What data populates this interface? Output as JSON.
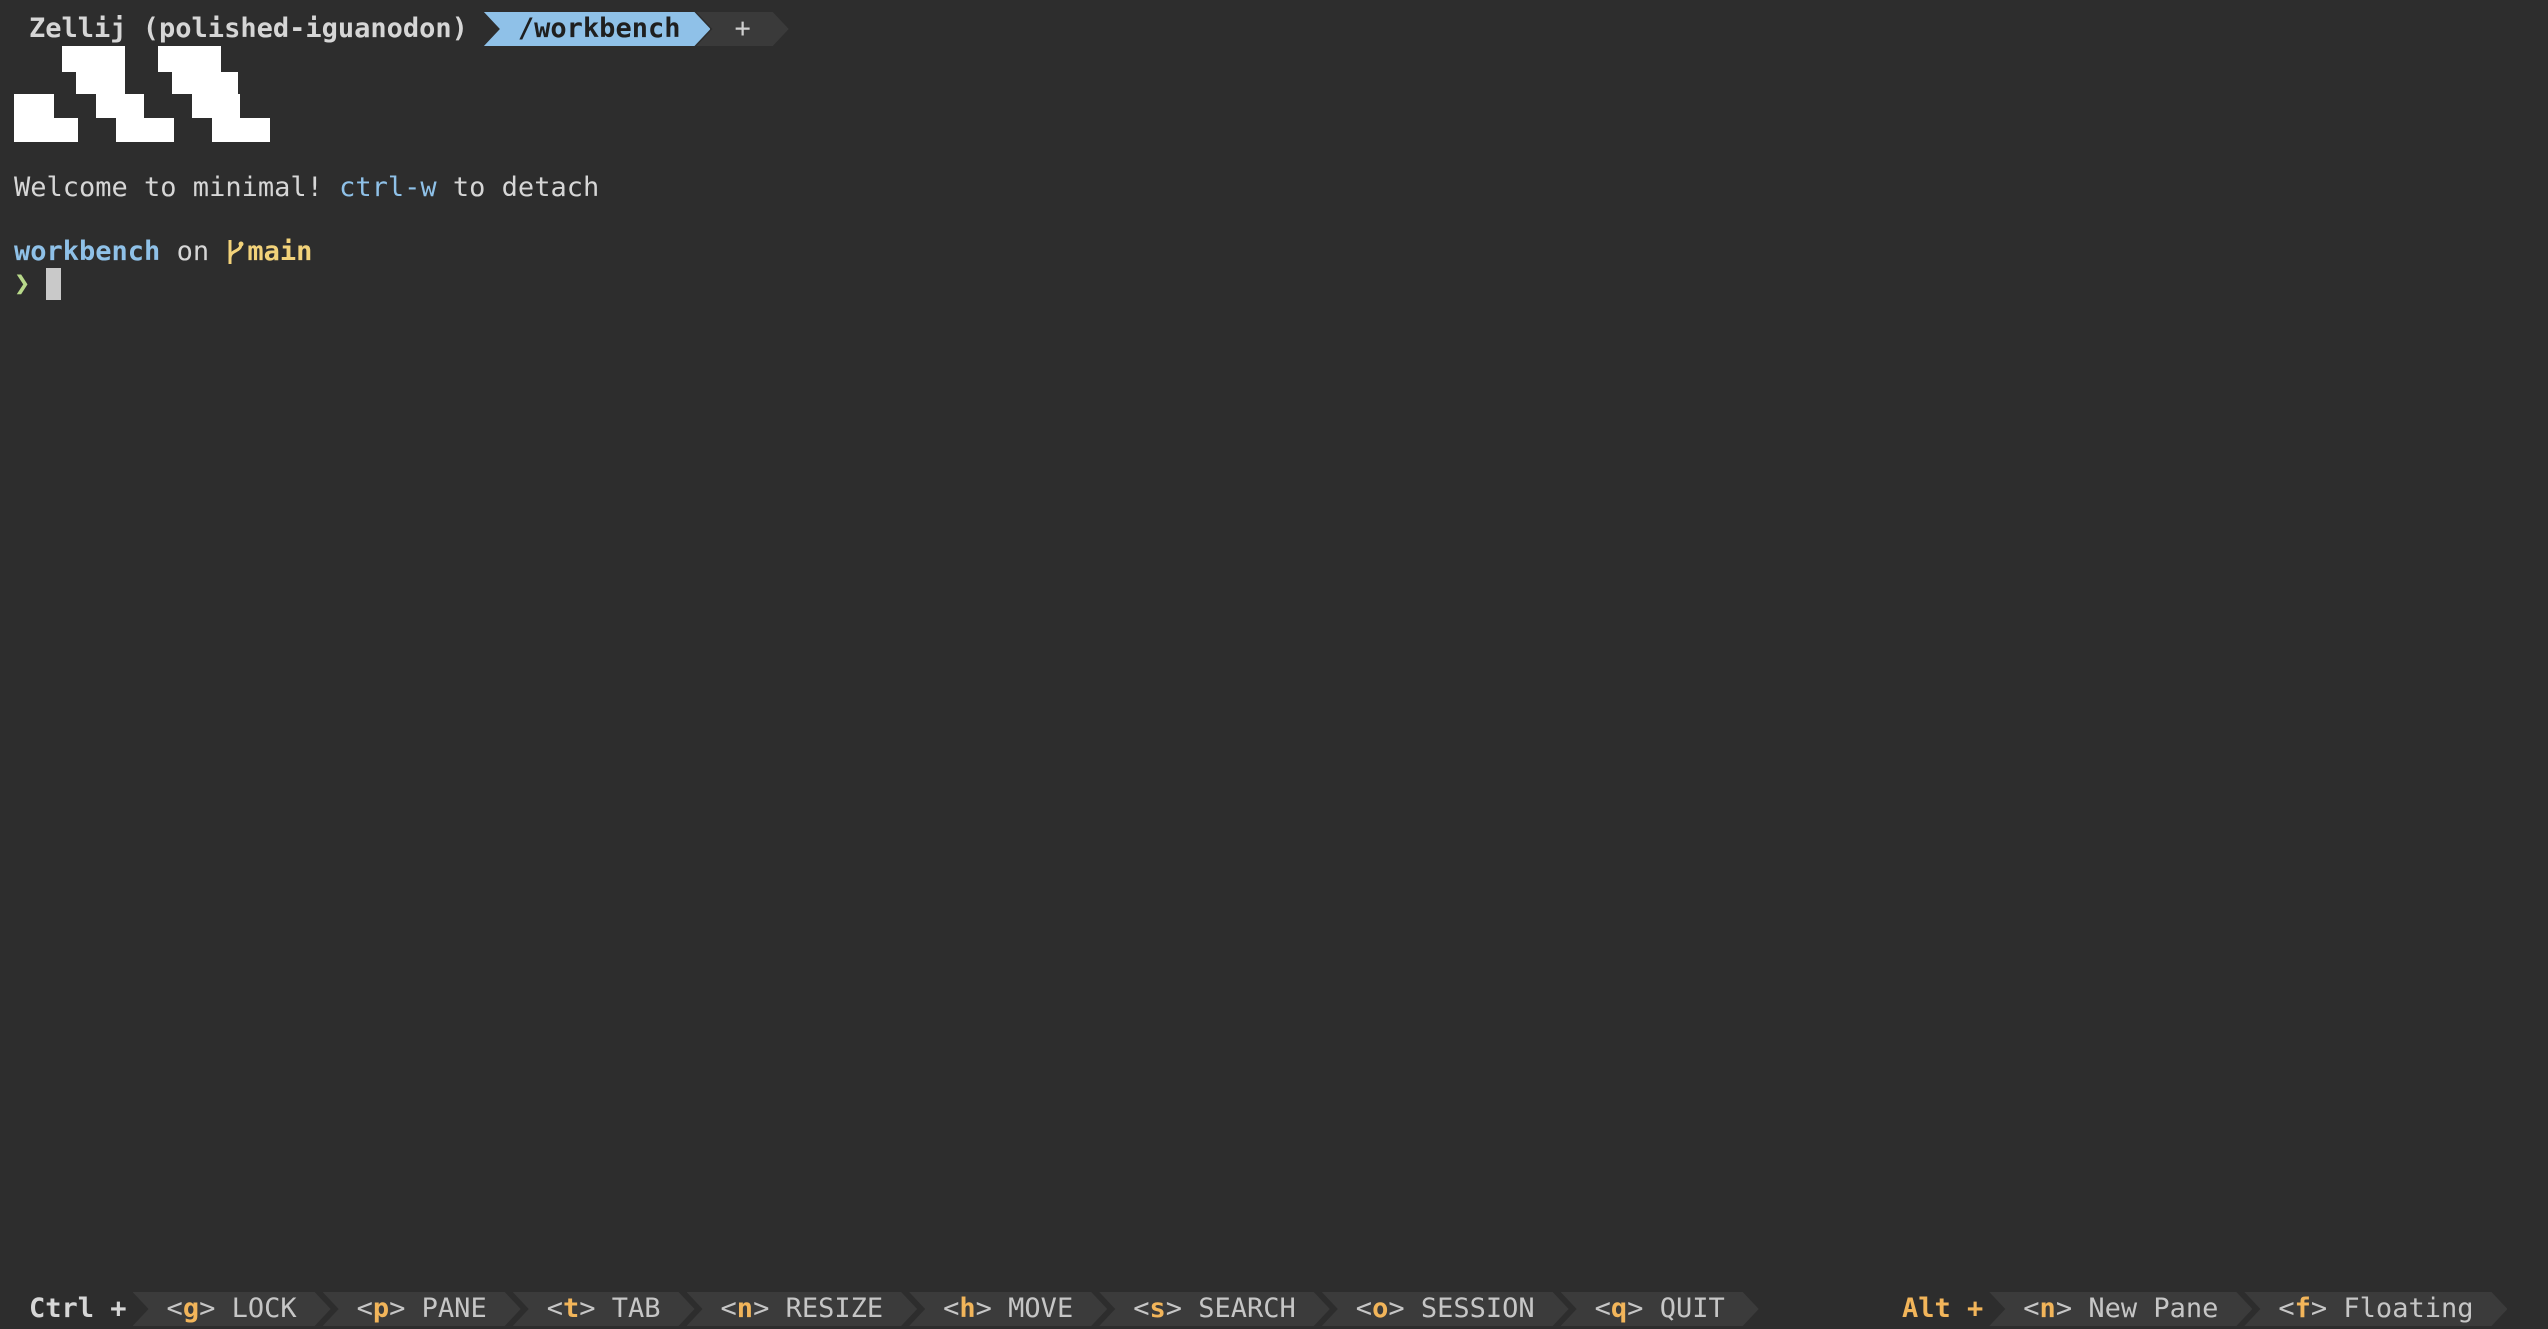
{
  "tabbar": {
    "session": "Zellij (polished-iguanodon)",
    "active_tab": "/workbench",
    "new_tab": "+"
  },
  "terminal": {
    "welcome_prefix": "Welcome to minimal! ",
    "welcome_key": "ctrl-w",
    "welcome_suffix": " to detach",
    "dir": "workbench",
    "on": " on ",
    "branch": "main",
    "prompt_char": "❯"
  },
  "statusbar": {
    "ctrl_prefix": "Ctrl +",
    "ctrl_keys": [
      {
        "key": "g",
        "label": "LOCK"
      },
      {
        "key": "p",
        "label": "PANE"
      },
      {
        "key": "t",
        "label": "TAB"
      },
      {
        "key": "n",
        "label": "RESIZE"
      },
      {
        "key": "h",
        "label": "MOVE"
      },
      {
        "key": "s",
        "label": "SEARCH"
      },
      {
        "key": "o",
        "label": "SESSION"
      },
      {
        "key": "q",
        "label": "QUIT"
      }
    ],
    "alt_prefix": "Alt +",
    "alt_keys": [
      {
        "key": "n",
        "label": "New Pane"
      },
      {
        "key": "f",
        "label": "Floating"
      }
    ]
  },
  "colors": {
    "background": "#2d2d2d",
    "active_tab": "#8fc1e8",
    "key_accent": "#f2b55a",
    "branch": "#f2d27a",
    "prompt": "#b8d98a"
  }
}
